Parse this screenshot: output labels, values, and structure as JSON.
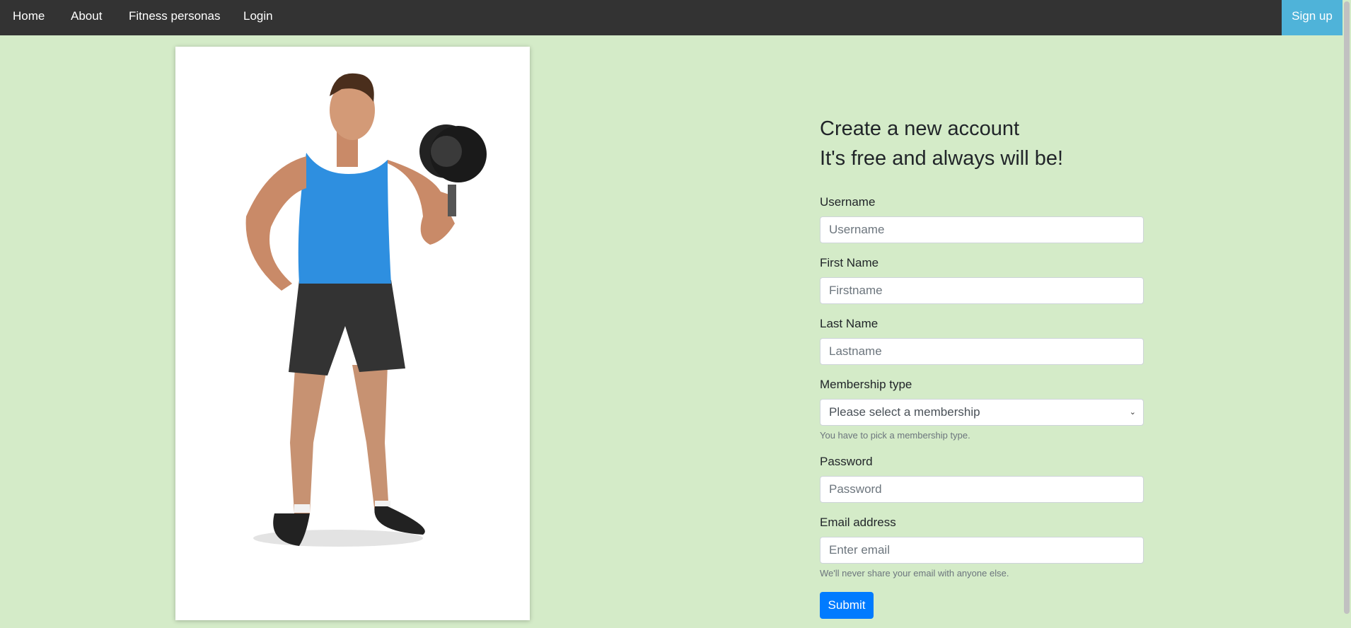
{
  "nav": {
    "items": [
      {
        "label": "Home"
      },
      {
        "label": "About"
      },
      {
        "label": "Fitness personas"
      },
      {
        "label": "Login"
      }
    ],
    "signup_label": "Sign up"
  },
  "colors": {
    "page_background": "#d4ebc8",
    "navbar": "#333333",
    "signup_button": "#4fb3d9",
    "submit_button": "#007bff"
  },
  "hero_image": {
    "icon": "fitness-man-with-dumbbell-photo"
  },
  "form": {
    "heading_line1": "Create a new account",
    "heading_line2": "It's free and always will be!",
    "username": {
      "label": "Username",
      "placeholder": "Username"
    },
    "firstname": {
      "label": "First Name",
      "placeholder": "Firstname"
    },
    "lastname": {
      "label": "Last Name",
      "placeholder": "Lastname"
    },
    "membership": {
      "label": "Membership type",
      "selected": "Please select a membership",
      "help": "You have to pick a membership type."
    },
    "password": {
      "label": "Password",
      "placeholder": "Password"
    },
    "email": {
      "label": "Email address",
      "placeholder": "Enter email",
      "help": "We'll never share your email with anyone else."
    },
    "submit_label": "Submit"
  }
}
